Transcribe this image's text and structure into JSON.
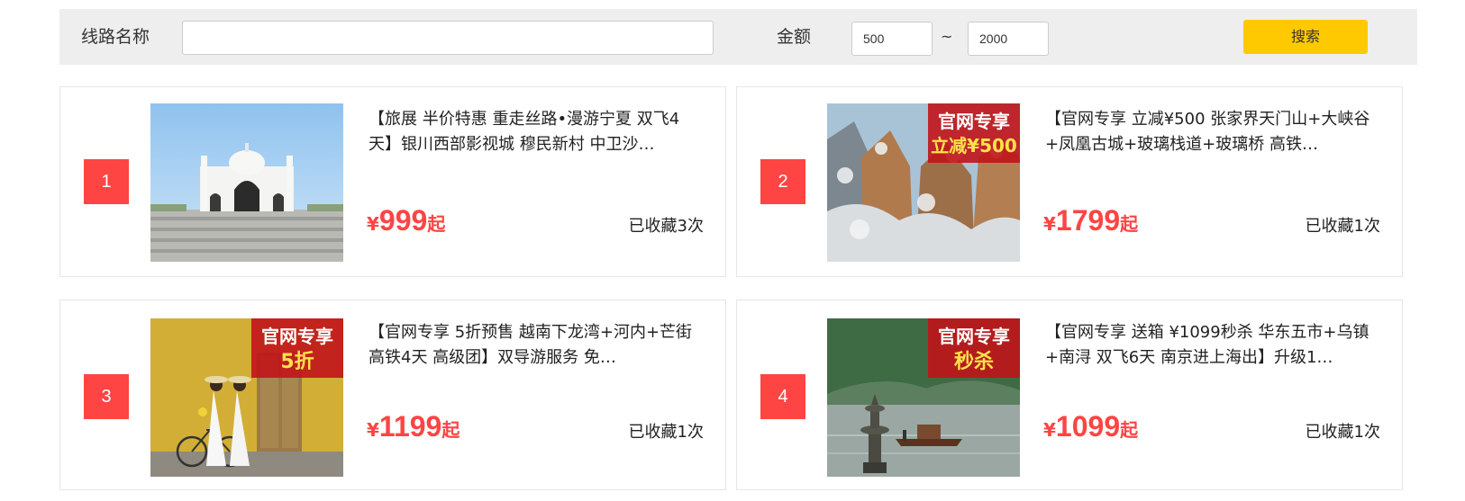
{
  "search": {
    "name_label": "线路名称",
    "name_value": "",
    "amount_label": "金额",
    "min_value": "500",
    "separator": "~",
    "max_value": "2000",
    "button_label": "搜索",
    "button_color": "#ffc900"
  },
  "colors": {
    "accent": "#ff4444",
    "panel": "#eeeeee"
  },
  "routes": [
    {
      "rank": "1",
      "title": "【旅展 半价特惠 重走丝路•漫游宁夏 双飞4天】银川西部影视城 穆民新村 中卫沙…",
      "currency": "¥",
      "price": "999",
      "price_suffix": "起",
      "favorites": "已收藏3次",
      "image": "white-mosque-photo"
    },
    {
      "rank": "2",
      "title": "【官网专享 立减¥500 张家界天门山+大峡谷+凤凰古城+玻璃栈道+玻璃桥 高铁…",
      "currency": "¥",
      "price": "1799",
      "price_suffix": "起",
      "favorites": "已收藏1次",
      "image": "snowy-cliffs-photo",
      "badge_lines": [
        "官网专享",
        "立减¥500"
      ]
    },
    {
      "rank": "3",
      "title": "【官网专享 5折预售 越南下龙湾+河内+芒街 高铁4天 高级团】双导游服务 免…",
      "currency": "¥",
      "price": "1199",
      "price_suffix": "起",
      "favorites": "已收藏1次",
      "image": "yellow-wall-ao-dai-photo",
      "badge_lines": [
        "官网专享",
        "5折"
      ]
    },
    {
      "rank": "4",
      "title": "【官网专享 送箱 ¥1099秒杀 华东五市+乌镇+南浔 双飞6天 南京进上海出】升级1…",
      "currency": "¥",
      "price": "1099",
      "price_suffix": "起",
      "favorites": "已收藏1次",
      "image": "west-lake-pagoda-photo",
      "badge_lines": [
        "官网专享",
        "秒杀"
      ]
    }
  ]
}
